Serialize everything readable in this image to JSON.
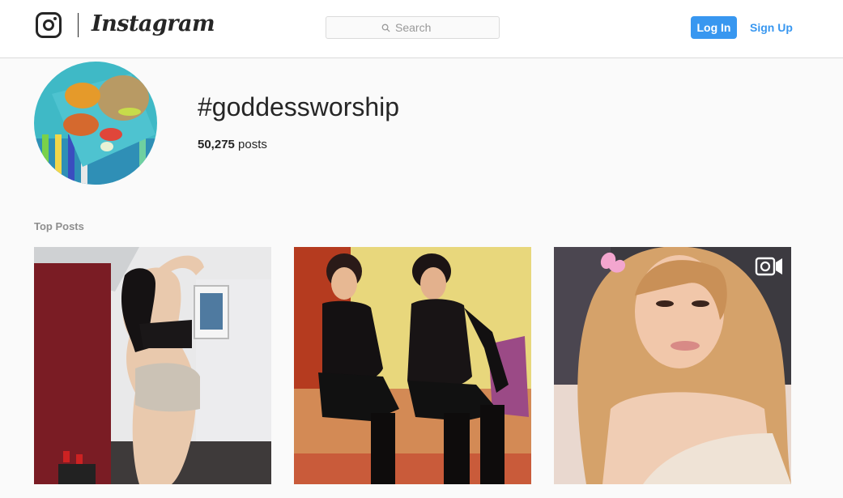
{
  "header": {
    "brand": "Instagram",
    "search_placeholder": "Search",
    "login_label": "Log In",
    "signup_label": "Sign Up"
  },
  "hashtag": {
    "title": "#goddessworship",
    "post_count": "50,275",
    "post_count_suffix": " posts"
  },
  "top_posts": {
    "label": "Top Posts",
    "posts": [
      {
        "icon": null
      },
      {
        "icon": null
      },
      {
        "icon": "video-icon"
      }
    ]
  },
  "colors": {
    "accent": "#3897f0",
    "border": "#dbdbdb",
    "background": "#fafafa"
  }
}
